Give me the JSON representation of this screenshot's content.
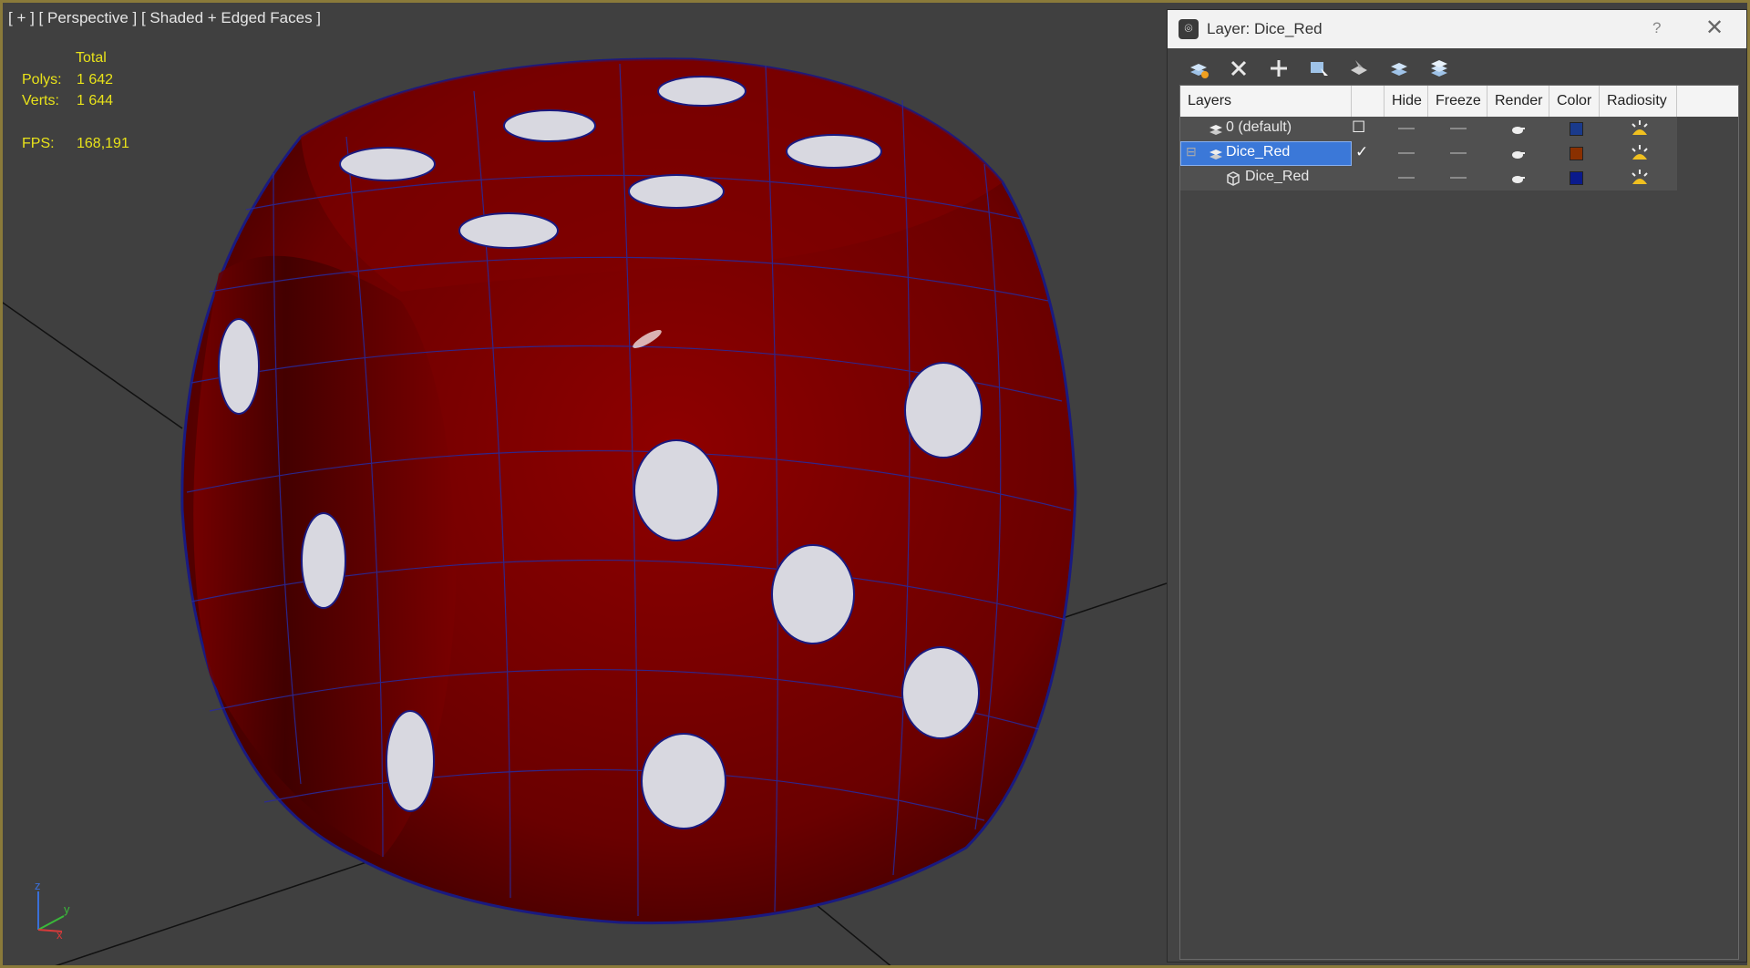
{
  "viewport": {
    "label": "[ + ] [ Perspective ] [ Shaded + Edged Faces ]",
    "stats": {
      "total_label": "Total",
      "polys_label": "Polys:",
      "polys_value": "1 642",
      "verts_label": "Verts:",
      "verts_value": "1 644",
      "fps_label": "FPS:",
      "fps_value": "168,191"
    },
    "axis": {
      "x": "x",
      "y": "y",
      "z": "z"
    },
    "object_color": "#7a0000",
    "edge_color": "#2a2a9a"
  },
  "dialog": {
    "title": "Layer: Dice_Red",
    "help": "?",
    "close": "✕",
    "toolbar_icons": [
      "create-new-layer-icon",
      "delete-layer-icon",
      "add-to-layer-icon",
      "select-objects-icon",
      "highlight-selected-icon",
      "hide-all-layers-icon",
      "freeze-all-layers-icon"
    ],
    "columns": [
      "Layers",
      "",
      "Hide",
      "Freeze",
      "Render",
      "Color",
      "Radiosity"
    ],
    "rows": [
      {
        "name": "0 (default)",
        "current": "☐",
        "color": "#1a3a8c",
        "selected": false
      },
      {
        "name": "Dice_Red",
        "current": "✓",
        "color": "#8a3000",
        "selected": true
      },
      {
        "name": "Dice_Red",
        "current": "",
        "color": "#0a1a8c",
        "selected": false
      }
    ]
  }
}
